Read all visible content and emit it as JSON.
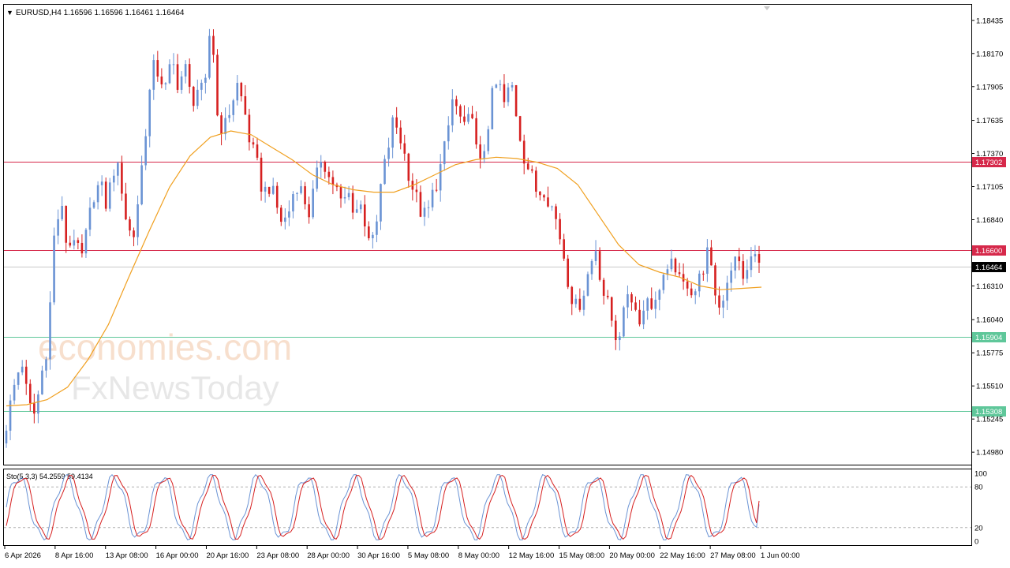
{
  "title": "EURUSD,H4  1.16596 1.16596 1.16461 1.16464",
  "collapse_icon": "triangle-down-icon",
  "watermark": {
    "primary": "economies.com",
    "secondary": "FxNewsToday"
  },
  "colors": {
    "bull": "#6a93d4",
    "bear": "#d62020",
    "ma": "#f0a020",
    "resistance": "#d6284a",
    "support": "#5fc79a",
    "current": "#c8c8c8",
    "sto_main": "#6a93d4",
    "sto_signal": "#d62020"
  },
  "chart_data": [
    {
      "type": "candlestick",
      "symbol": "EURUSD",
      "timeframe": "H4",
      "ohlc_header": {
        "open": 1.16596,
        "high": 1.16596,
        "low": 1.16461,
        "close": 1.16464
      },
      "ylim": [
        1.1488,
        1.1856
      ],
      "y_ticks": [
        "1.18435",
        "1.18170",
        "1.17905",
        "1.17635",
        "1.17370",
        "1.17105",
        "1.16840",
        "1.16575",
        "1.16310",
        "1.16040",
        "1.15775",
        "1.15510",
        "1.15245",
        "1.14980"
      ],
      "x_ticks": [
        "6 Apr 2026",
        "8 Apr 16:00",
        "13 Apr 08:00",
        "16 Apr 00:00",
        "20 Apr 16:00",
        "23 Apr 08:00",
        "28 Apr 00:00",
        "30 Apr 16:00",
        "5 May 08:00",
        "8 May 00:00",
        "12 May 16:00",
        "15 May 08:00",
        "20 May 00:00",
        "22 May 16:00",
        "27 May 08:00",
        "1 Jun 00:00"
      ],
      "key_levels": [
        {
          "label": "1.17302",
          "value": 1.17302,
          "kind": "resistance"
        },
        {
          "label": "1.16600",
          "value": 1.166,
          "kind": "resistance"
        },
        {
          "label": "1.16464",
          "value": 1.16464,
          "kind": "current"
        },
        {
          "label": "1.15904",
          "value": 1.15904,
          "kind": "support"
        },
        {
          "label": "1.15308",
          "value": 1.15308,
          "kind": "support"
        }
      ],
      "price_path": [
        1.1505,
        1.153,
        1.1555,
        1.1572,
        1.1535,
        1.1528,
        1.156,
        1.1588,
        1.1675,
        1.1695,
        1.166,
        1.1672,
        1.1648,
        1.1675,
        1.1705,
        1.1712,
        1.1695,
        1.1725,
        1.1722,
        1.1684,
        1.1666,
        1.1708,
        1.1758,
        1.1805,
        1.1802,
        1.1788,
        1.1811,
        1.1792,
        1.1806,
        1.1778,
        1.179,
        1.1782,
        1.1848,
        1.1765,
        1.1755,
        1.1775,
        1.1792,
        1.1775,
        1.1745,
        1.1728,
        1.1705,
        1.1712,
        1.1695,
        1.168,
        1.1692,
        1.1715,
        1.1705,
        1.169,
        1.1712,
        1.1738,
        1.1718,
        1.1712,
        1.1695,
        1.1705,
        1.1692,
        1.1695,
        1.1675,
        1.1662,
        1.171,
        1.1738,
        1.1765,
        1.175,
        1.1728,
        1.1708,
        1.1692,
        1.1685,
        1.1705,
        1.1722,
        1.1745,
        1.178,
        1.1768,
        1.1752,
        1.1775,
        1.172,
        1.1745,
        1.178,
        1.1795,
        1.1775,
        1.1795,
        1.1762,
        1.1735,
        1.172,
        1.1705,
        1.171,
        1.1698,
        1.1682,
        1.1658,
        1.1628,
        1.1612,
        1.1625,
        1.1645,
        1.1662,
        1.1628,
        1.1612,
        1.1592,
        1.1598,
        1.1632,
        1.1612,
        1.1605,
        1.1625,
        1.1612,
        1.164,
        1.1638,
        1.1652,
        1.1628,
        1.1635,
        1.1625,
        1.1638,
        1.1658,
        1.1632,
        1.1612,
        1.1635,
        1.1652,
        1.1648,
        1.1635,
        1.166,
        1.1646
      ],
      "ma_path": [
        1.1535,
        1.1536,
        1.154,
        1.155,
        1.1572,
        1.16,
        1.1638,
        1.1675,
        1.171,
        1.1735,
        1.175,
        1.1755,
        1.1752,
        1.1742,
        1.1732,
        1.172,
        1.1712,
        1.1708,
        1.1706,
        1.1706,
        1.1712,
        1.172,
        1.1728,
        1.1732,
        1.1734,
        1.1733,
        1.173,
        1.1725,
        1.1712,
        1.1688,
        1.1664,
        1.1648,
        1.1642,
        1.1638,
        1.1631,
        1.1628,
        1.1629,
        1.163
      ]
    },
    {
      "type": "line",
      "indicator": "Sto(5,3,3)",
      "label": "Sto(5,3,3) 54.2559 59.4134",
      "main": 54.2559,
      "signal": 59.4134,
      "ylim": [
        0,
        100
      ],
      "y_ticks": [
        "100",
        "80",
        "20",
        "0"
      ],
      "levels": [
        80,
        20
      ]
    }
  ]
}
